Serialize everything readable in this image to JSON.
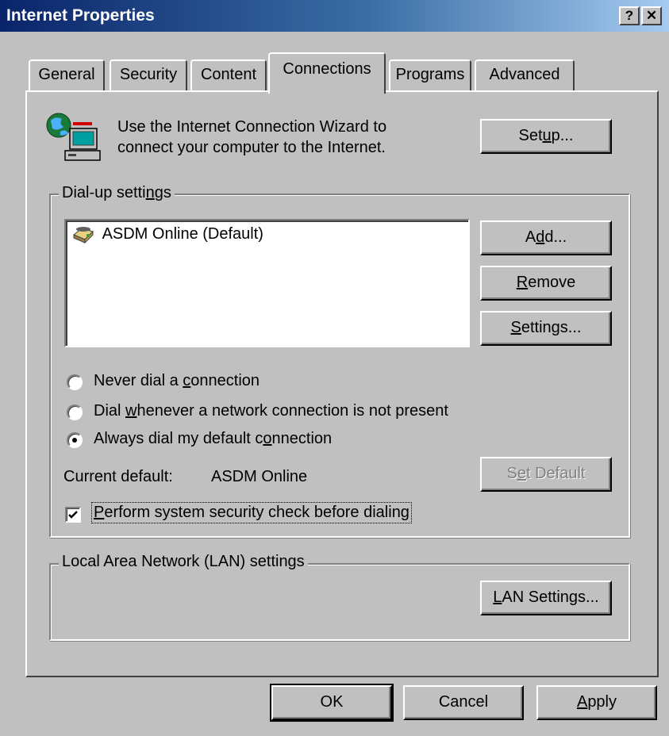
{
  "window": {
    "title": "Internet Properties",
    "help_label": "?",
    "close_label": "✕"
  },
  "tabs": [
    {
      "label": "General"
    },
    {
      "label": "Security"
    },
    {
      "label": "Content"
    },
    {
      "label": "Connections",
      "active": true
    },
    {
      "label": "Programs"
    },
    {
      "label": "Advanced"
    }
  ],
  "wizard": {
    "text_line1": "Use the Internet Connection Wizard to",
    "text_line2": "connect your computer to the Internet.",
    "setup_pre": "Set",
    "setup_key": "u",
    "setup_post": "p..."
  },
  "dialup": {
    "group_pre": "Dial-up setti",
    "group_key": "n",
    "group_post": "gs",
    "list_items": [
      {
        "label": "ASDM Online (Default)",
        "icon": "dialup-connection-icon"
      }
    ],
    "add_pre": "A",
    "add_key": "d",
    "add_post": "d...",
    "remove_key": "R",
    "remove_post": "emove",
    "settings_key": "S",
    "settings_post": "ettings...",
    "radio_never_pre": "Never dial a ",
    "radio_never_key": "c",
    "radio_never_post": "onnection",
    "radio_whenever_pre": "Dial ",
    "radio_whenever_key": "w",
    "radio_whenever_post": "henever a network connection is not present",
    "radio_always_pre": "Always dial my default c",
    "radio_always_key": "o",
    "radio_always_post": "nnection",
    "selected_radio": "always",
    "current_default_label": "Current default:",
    "current_default_value": "ASDM Online",
    "set_default_pre": "S",
    "set_default_key": "e",
    "set_default_post": "t Default",
    "security_check_key": "P",
    "security_check_post": "erform system security check before dialing",
    "security_check_checked": true
  },
  "lan": {
    "group_label": "Local Area Network (LAN) settings",
    "button_key": "L",
    "button_post": "AN Settings..."
  },
  "footer": {
    "ok_label": "OK",
    "cancel_label": "Cancel",
    "apply_key": "A",
    "apply_post": "pply"
  },
  "colors": {
    "title_gradient_start": "#0a246a",
    "title_gradient_end": "#a6caf0",
    "face": "#c0c0c0"
  }
}
